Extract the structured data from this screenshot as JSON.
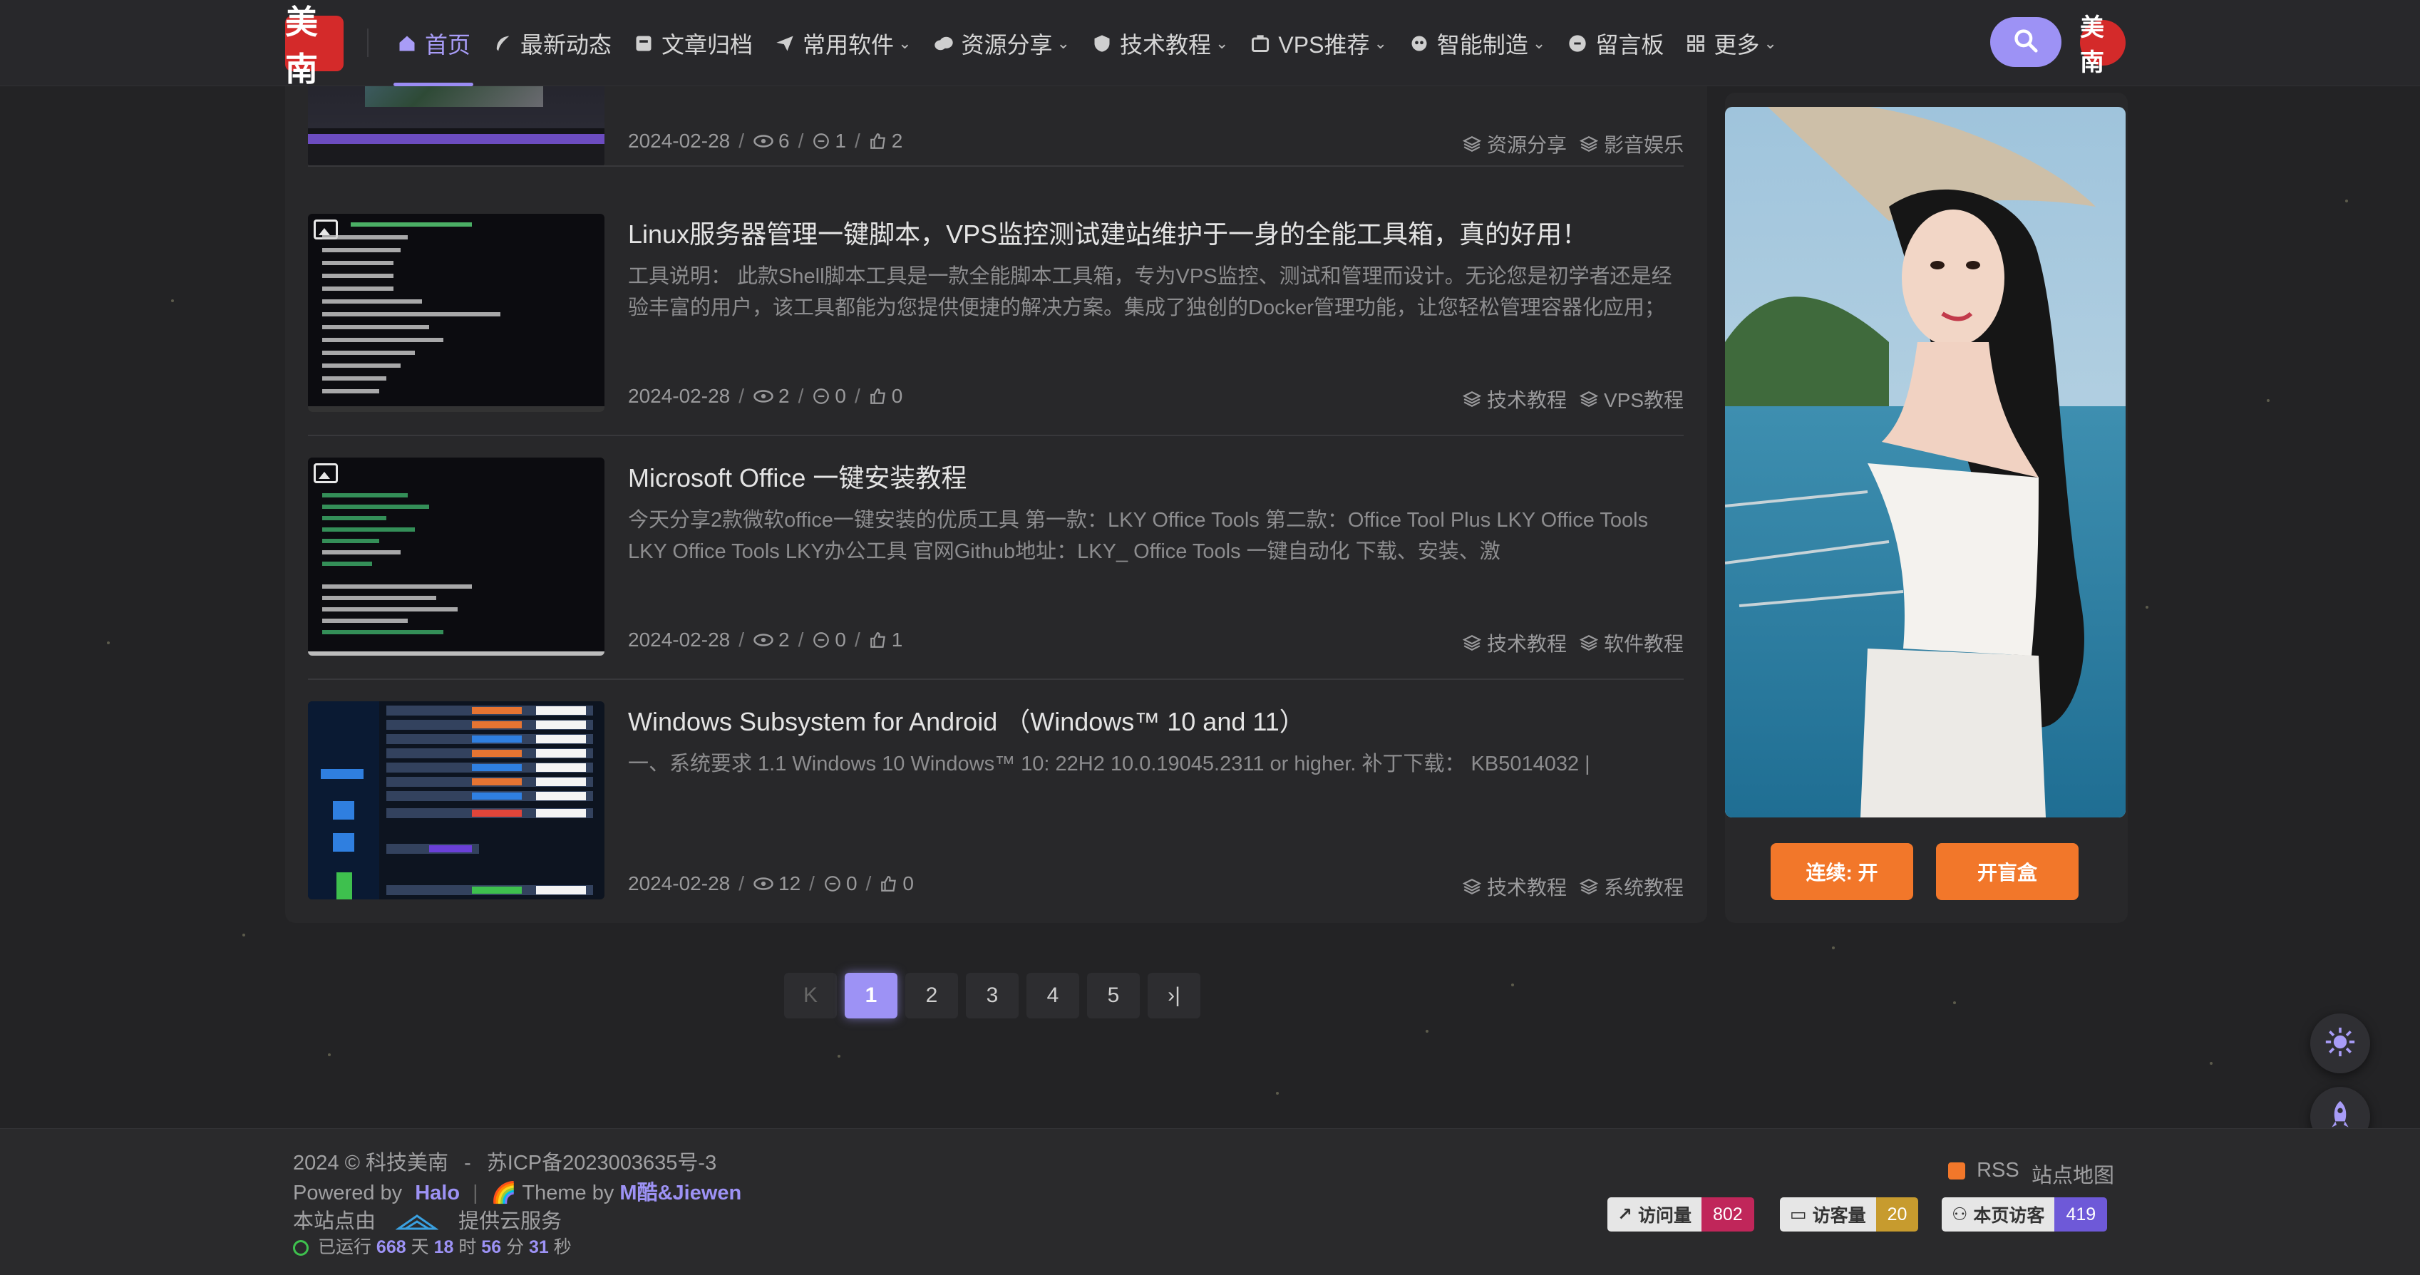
{
  "header": {
    "logo_text": "美南",
    "avatar_text": "美南",
    "nav": [
      {
        "label": "首页",
        "icon": "home-icon"
      },
      {
        "label": "最新动态",
        "icon": "feather-icon"
      },
      {
        "label": "文章归档",
        "icon": "archive-icon"
      },
      {
        "label": "常用软件",
        "icon": "send-icon"
      },
      {
        "label": "资源分享",
        "icon": "cloud-icon"
      },
      {
        "label": "技术教程",
        "icon": "shield-icon"
      },
      {
        "label": "VPS推荐",
        "icon": "server-icon"
      },
      {
        "label": "智能制造",
        "icon": "robot-icon"
      },
      {
        "label": "留言板",
        "icon": "message-icon"
      },
      {
        "label": "更多",
        "icon": "grid-icon"
      }
    ]
  },
  "posts": [
    {
      "title": "",
      "excerpt": "",
      "date": "2024-02-28",
      "views": "6",
      "comments": "1",
      "likes": "2",
      "tags": [
        "资源分享",
        "影音娱乐"
      ]
    },
    {
      "title": "Linux服务器管理一键脚本，VPS监控测试建站维护于一身的全能工具箱，真的好用！",
      "excerpt": "工具说明： 此款Shell脚本工具是一款全能脚本工具箱，专为VPS监控、测试和管理而设计。无论您是初学者还是经验丰富的用户，该工具都能为您提供便捷的解决方案。集成了独创的Docker管理功能，让您轻松管理容器化应用；LNMP…",
      "date": "2024-02-28",
      "views": "2",
      "comments": "0",
      "likes": "0",
      "tags": [
        "技术教程",
        "VPS教程"
      ]
    },
    {
      "title": "Microsoft Office 一键安装教程",
      "excerpt": "今天分享2款微软office一键安装的优质工具 第一款：LKY Office Tools 第二款：Office Tool Plus LKY Office Tools LKY Office Tools LKY办公工具 官网Github地址：LKY_ Office Tools 一键自动化 下载、安装、激",
      "date": "2024-02-28",
      "views": "2",
      "comments": "0",
      "likes": "1",
      "tags": [
        "技术教程",
        "软件教程"
      ]
    },
    {
      "title": "Windows Subsystem for Android （Windows™ 10 and 11）",
      "excerpt": "一、系统要求 1.1 Windows 10 Windows™ 10: 22H2 10.0.19045.2311 or higher. 补丁下载： KB5014032 |",
      "date": "2024-02-28",
      "views": "12",
      "comments": "0",
      "likes": "0",
      "tags": [
        "技术教程",
        "系统教程"
      ]
    }
  ],
  "sidebar": {
    "btn_continuous": "连续: 开",
    "btn_blindbox": "开盲盒"
  },
  "pager": {
    "first": "K",
    "pages": [
      "1",
      "2",
      "3",
      "4",
      "5"
    ],
    "last": "›|",
    "current": "1"
  },
  "footer": {
    "copyright": "2024 © 科技美南",
    "dash": "-",
    "icp": "苏ICP备2023003635号-3",
    "powered_prefix": "Powered by",
    "powered_link": "Halo",
    "theme_prefix": "Theme by",
    "theme_link": "M酷&Jiewen",
    "host_prefix": "本站点由",
    "host_suffix": "提供云服务",
    "uptime_prefix": "已运行",
    "uptime_days": "668",
    "uptime_days_unit": "天",
    "uptime_hours": "18",
    "uptime_hours_unit": "时",
    "uptime_mins": "56",
    "uptime_mins_unit": "分",
    "uptime_secs": "31",
    "uptime_secs_unit": "秒",
    "rss": "RSS",
    "sitemap": "站点地图",
    "badges": [
      {
        "label": "访问量",
        "value": "802",
        "color": "#c0265a"
      },
      {
        "label": "访客量",
        "value": "20",
        "color": "#c79b2e"
      },
      {
        "label": "本页访客",
        "value": "419",
        "color": "#6e59d8"
      }
    ]
  },
  "colors": {
    "accent": "#9d92f5",
    "orange": "#f2772a",
    "background": "#232325"
  }
}
